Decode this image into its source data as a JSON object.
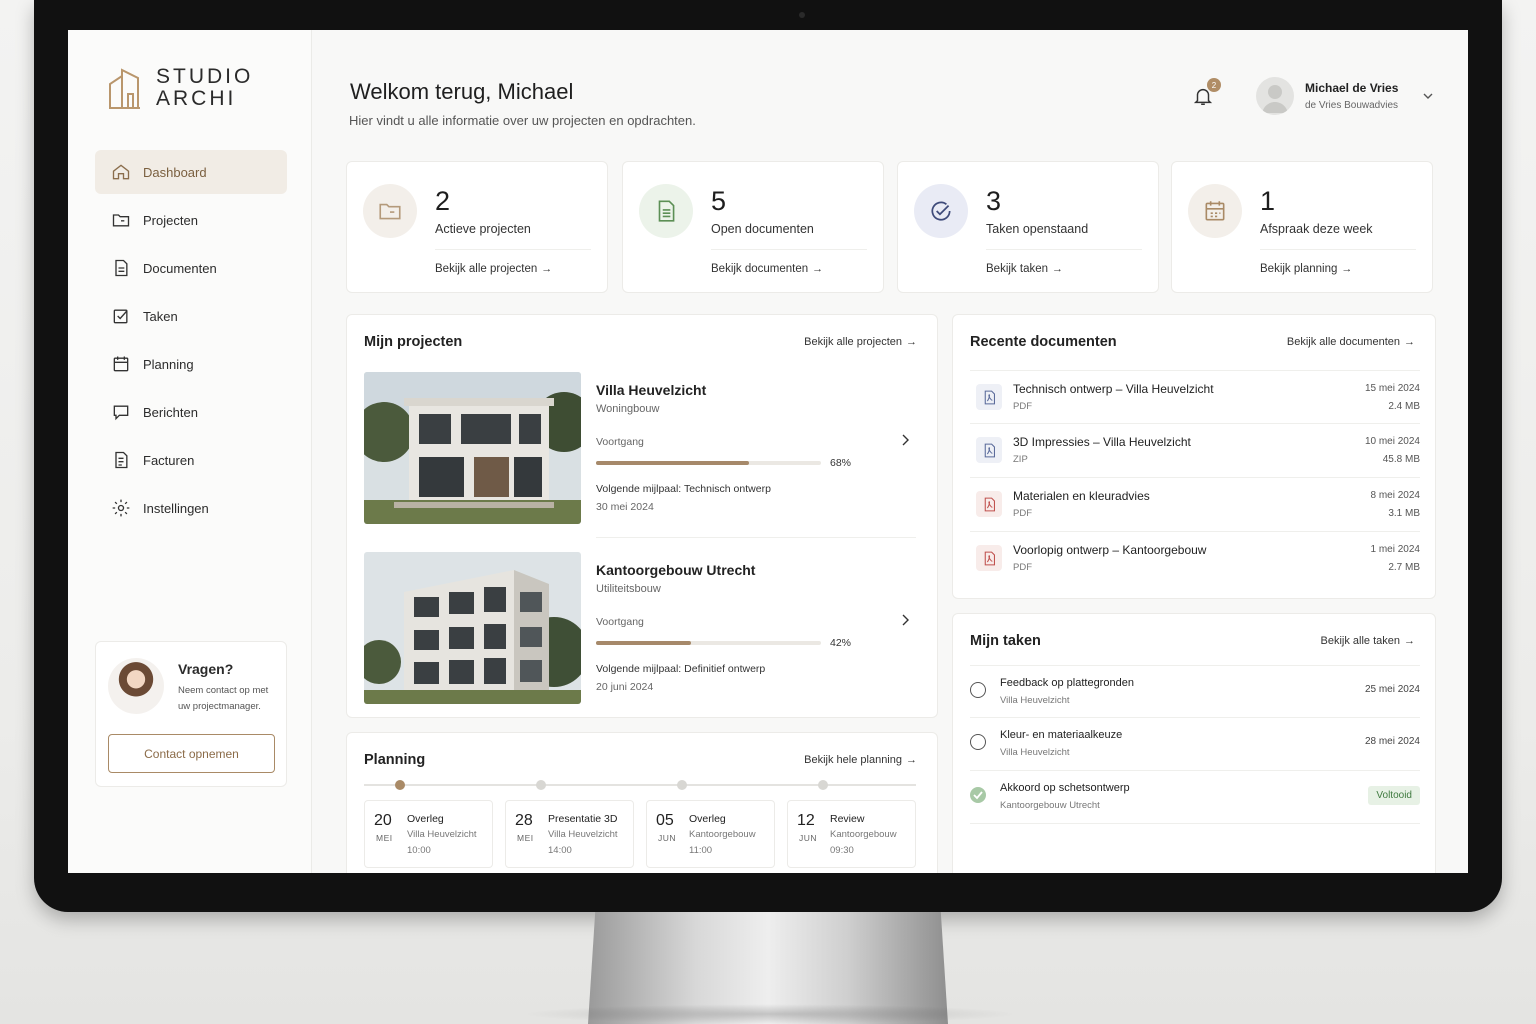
{
  "brand": {
    "line1": "STUDIO",
    "line2": "ARCHI"
  },
  "sidebar": {
    "items": [
      {
        "label": "Dashboard",
        "icon": "home-icon",
        "active": true
      },
      {
        "label": "Projecten",
        "icon": "folder-icon"
      },
      {
        "label": "Documenten",
        "icon": "document-icon"
      },
      {
        "label": "Taken",
        "icon": "checkbox-icon"
      },
      {
        "label": "Planning",
        "icon": "calendar-icon"
      },
      {
        "label": "Berichten",
        "icon": "message-icon"
      },
      {
        "label": "Facturen",
        "icon": "invoice-icon"
      },
      {
        "label": "Instellingen",
        "icon": "gear-icon"
      }
    ],
    "help": {
      "title": "Vragen?",
      "text": "Neem contact op met uw projectmanager.",
      "button": "Contact opnemen"
    }
  },
  "header": {
    "greeting": "Welkom terug, Michael",
    "subtitle": "Hier vindt u alle informatie over uw projecten en opdrachten.",
    "notifications": "2",
    "user": {
      "name": "Michael de Vries",
      "company": "de Vries Bouwadvies"
    }
  },
  "stats": [
    {
      "value": "2",
      "label": "Actieve projecten",
      "link": "Bekijk alle projecten",
      "icon": "folder-icon",
      "color": "#f3efea"
    },
    {
      "value": "5",
      "label": "Open documenten",
      "link": "Bekijk documenten",
      "icon": "document-icon",
      "color": "#ecf3ea"
    },
    {
      "value": "3",
      "label": "Taken openstaand",
      "link": "Bekijk taken",
      "icon": "check-circle-icon",
      "color": "#e9ebf5"
    },
    {
      "value": "1",
      "label": "Afspraak deze week",
      "link": "Bekijk planning",
      "icon": "calendar-icon",
      "color": "#f3efea"
    }
  ],
  "projects": {
    "title": "Mijn projecten",
    "link": "Bekijk alle projecten",
    "items": [
      {
        "name": "Villa Heuvelzicht",
        "type": "Woningbouw",
        "progress_label": "Voortgang",
        "progress": 68,
        "progress_text": "68%",
        "milestone": "Volgende mijlpaal: Technisch ontwerp",
        "date": "30 mei 2024"
      },
      {
        "name": "Kantoorgebouw Utrecht",
        "type": "Utiliteitsbouw",
        "progress_label": "Voortgang",
        "progress": 42,
        "progress_text": "42%",
        "milestone": "Volgende mijlpaal: Definitief ontwerp",
        "date": "20 juni 2024"
      }
    ]
  },
  "planning": {
    "title": "Planning",
    "link": "Bekijk hele planning",
    "items": [
      {
        "day": "20",
        "month": "MEI",
        "title": "Overleg",
        "project": "Villa Heuvelzicht",
        "time": "10:00"
      },
      {
        "day": "28",
        "month": "MEI",
        "title": "Presentatie 3D",
        "project": "Villa Heuvelzicht",
        "time": "14:00"
      },
      {
        "day": "05",
        "month": "JUN",
        "title": "Overleg",
        "project": "Kantoorgebouw",
        "time": "11:00"
      },
      {
        "day": "12",
        "month": "JUN",
        "title": "Review",
        "project": "Kantoorgebouw",
        "time": "09:30"
      }
    ]
  },
  "documents": {
    "title": "Recente documenten",
    "link": "Bekijk alle documenten",
    "items": [
      {
        "name": "Technisch ontwerp – Villa Heuvelzicht",
        "type": "PDF",
        "date": "15 mei 2024",
        "size": "2.4 MB",
        "color": "#5a6a9a"
      },
      {
        "name": "3D Impressies – Villa Heuvelzicht",
        "type": "ZIP",
        "date": "10 mei 2024",
        "size": "45.8 MB",
        "color": "#5a6a9a"
      },
      {
        "name": "Materialen en kleuradvies",
        "type": "PDF",
        "date": "8 mei 2024",
        "size": "3.1 MB",
        "color": "#c0504d"
      },
      {
        "name": "Voorlopig ontwerp – Kantoorgebouw",
        "type": "PDF",
        "date": "1 mei 2024",
        "size": "2.7 MB",
        "color": "#c0504d"
      }
    ]
  },
  "tasks": {
    "title": "Mijn taken",
    "link": "Bekijk alle taken",
    "items": [
      {
        "name": "Feedback op plattegronden",
        "project": "Villa Heuvelzicht",
        "date": "25 mei 2024",
        "done": false
      },
      {
        "name": "Kleur- en materiaalkeuze",
        "project": "Villa Heuvelzicht",
        "date": "28 mei 2024",
        "done": false
      },
      {
        "name": "Akkoord op schetsontwerp",
        "project": "Kantoorgebouw Utrecht",
        "status": "Voltooid",
        "done": true
      }
    ]
  }
}
